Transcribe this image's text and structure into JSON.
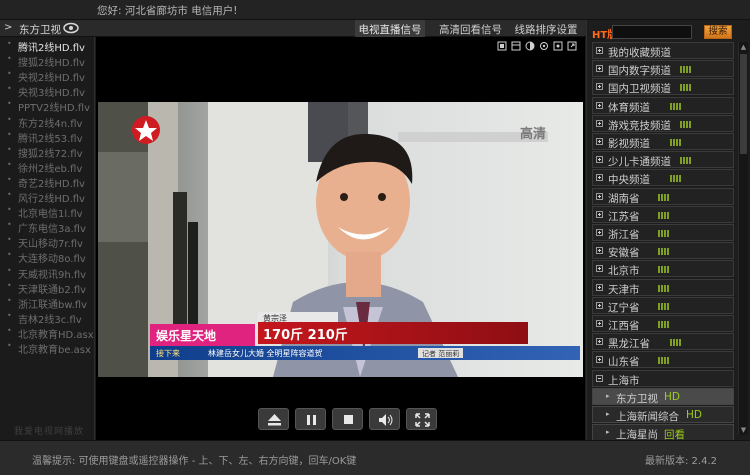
{
  "top_bar": {
    "location": "您好: 河北省廊坊市 电信用户!"
  },
  "header": {
    "current_channel": "东方卫视",
    "tabs": [
      {
        "label": "电视直播信号",
        "active": true
      },
      {
        "label": "高清回看信号",
        "active": false
      },
      {
        "label": "线路排序设置",
        "active": false
      }
    ]
  },
  "sources": {
    "items": [
      {
        "label": "腾讯2线HD.flv",
        "selected": true
      },
      {
        "label": "搜狐2线HD.flv"
      },
      {
        "label": "央视2线HD.flv"
      },
      {
        "label": "央视3线HD.flv"
      },
      {
        "label": "PPTV2线HD.flv"
      },
      {
        "label": "东方2线4n.flv"
      },
      {
        "label": "腾讯2线53.flv"
      },
      {
        "label": "搜狐2线72.flv"
      },
      {
        "label": "徐州2线eb.flv"
      },
      {
        "label": "奇艺2线HD.flv"
      },
      {
        "label": "风行2线HD.flv"
      },
      {
        "label": "北京电信1l.flv"
      },
      {
        "label": "广东电信3a.flv"
      },
      {
        "label": "天山移动7r.flv"
      },
      {
        "label": "大连移动8o.flv"
      },
      {
        "label": "天威视讯9h.flv"
      },
      {
        "label": "天津联通b2.flv"
      },
      {
        "label": "浙江联通bw.flv"
      },
      {
        "label": "吉林2线3c.flv"
      },
      {
        "label": "北京教育HD.asx"
      },
      {
        "label": "北京教育be.asx"
      }
    ],
    "footer": "我爱电视网播放"
  },
  "video": {
    "watermark": "高清",
    "name_tag": "黄宗泽",
    "headline": "170斤 210斤",
    "station_tag": "娱乐星天地",
    "subline": "林建岳女儿大婚 全明星阵容道贺",
    "next_label": "接下来",
    "reporter": "记者 范丽莉"
  },
  "right_panel": {
    "logo": "HT版",
    "search_placeholder": "",
    "search_button": "搜索",
    "groups": [
      {
        "label": "我的收藏频道",
        "signal": 0
      },
      {
        "label": "国内数字频道",
        "signal": 4
      },
      {
        "label": "国内卫视频道",
        "signal": 4
      },
      {
        "label": "体育频道",
        "signal": 4
      },
      {
        "label": "游戏竞技频道",
        "signal": 4
      },
      {
        "label": "影视频道",
        "signal": 4
      },
      {
        "label": "少儿卡通频道",
        "signal": 4
      },
      {
        "label": "中央频道",
        "signal": 4
      },
      {
        "label": "湖南省",
        "signal": 4
      },
      {
        "label": "江苏省",
        "signal": 4
      },
      {
        "label": "浙江省",
        "signal": 4
      },
      {
        "label": "安徽省",
        "signal": 4
      },
      {
        "label": "北京市",
        "signal": 4
      },
      {
        "label": "天津市",
        "signal": 4
      },
      {
        "label": "辽宁省",
        "signal": 4
      },
      {
        "label": "江西省",
        "signal": 4
      },
      {
        "label": "黑龙江省",
        "signal": 4
      },
      {
        "label": "山东省",
        "signal": 4
      },
      {
        "label": "上海市",
        "signal": 0,
        "expanded": true
      }
    ],
    "sub_items": [
      {
        "label": "东方卫视",
        "tag": "HD",
        "selected": true
      },
      {
        "label": "上海新闻综合",
        "tag": "HD"
      },
      {
        "label": "上海星尚",
        "tag": "回看"
      }
    ]
  },
  "bottom": {
    "tip": "温馨提示:   可使用键盘或遥控器操作 - 上、下、左、右方向键，回车/OK键",
    "version": "最新版本:   2.4.2"
  },
  "colors": {
    "accent": "#ff6a1a",
    "hd_tag": "#9ccc1e",
    "signal": "#7fa020"
  }
}
